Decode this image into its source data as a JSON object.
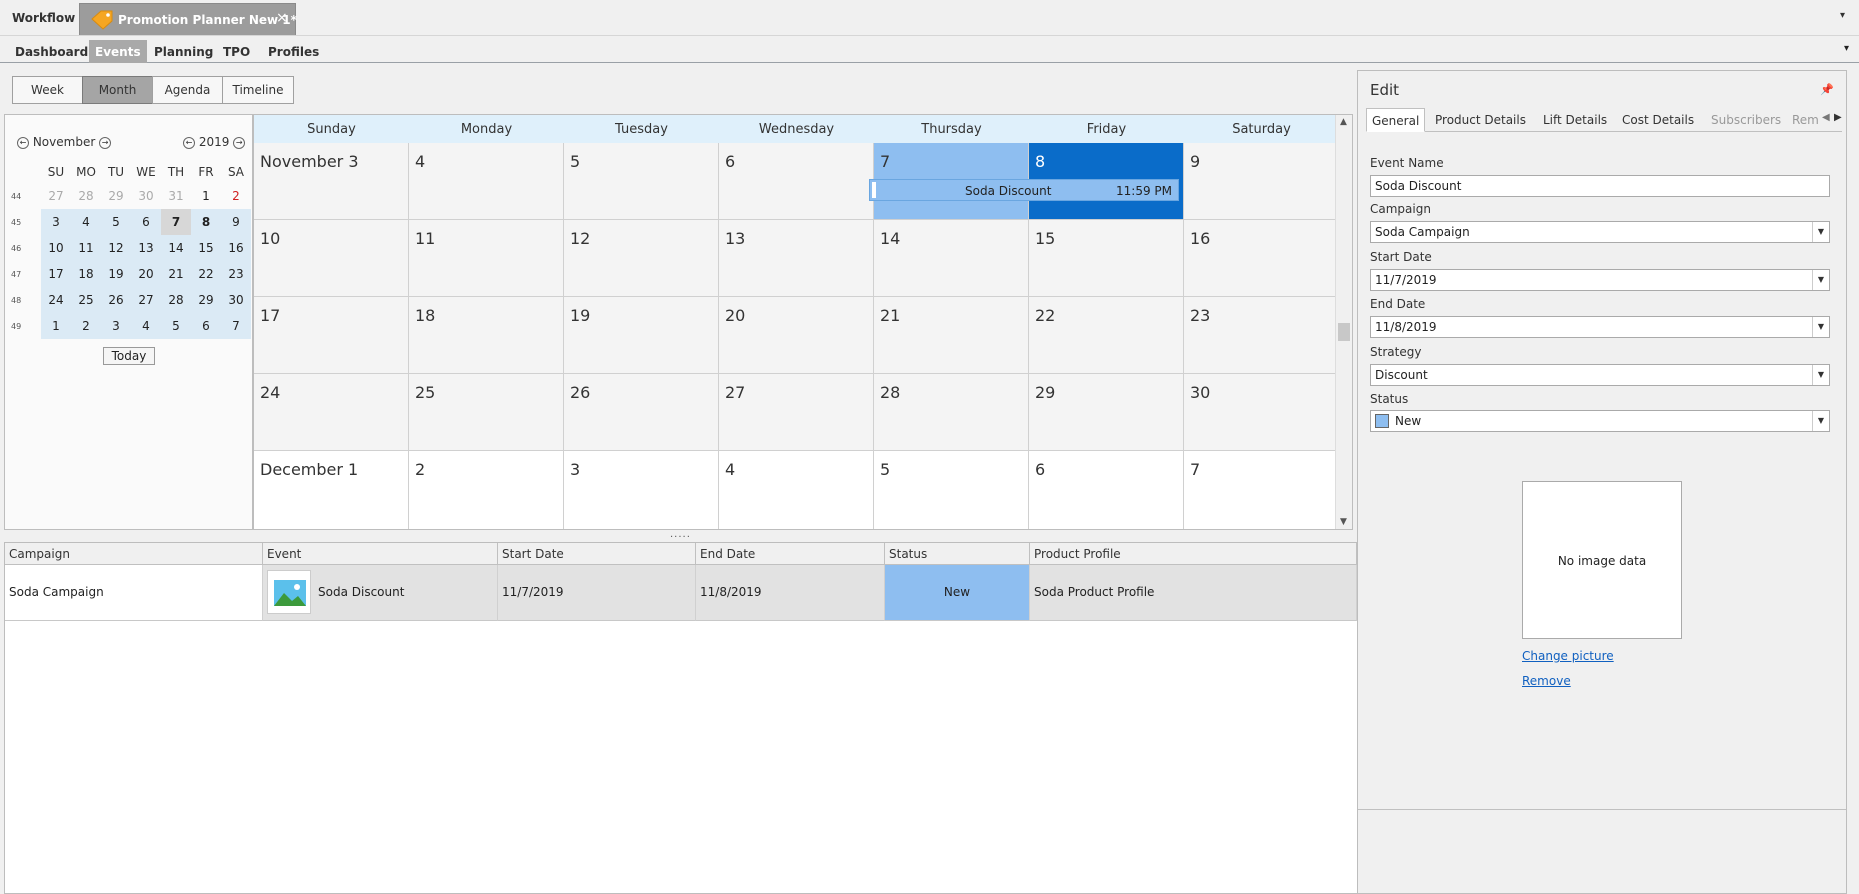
{
  "docbar": {
    "workflow": "Workflow",
    "doc_tab_title": "Promotion Planner New 1*",
    "close_glyph": "×",
    "menu_glyph": "▾"
  },
  "ribbon": {
    "tabs": [
      "Dashboard",
      "Events",
      "Planning",
      "TPO",
      "Profiles"
    ],
    "active": "Events"
  },
  "view_buttons": {
    "items": [
      "Week",
      "Month",
      "Agenda",
      "Timeline"
    ],
    "active": "Month"
  },
  "mini_calendar": {
    "month": "November",
    "year": "2019",
    "day_headers": [
      "SU",
      "MO",
      "TU",
      "WE",
      "TH",
      "FR",
      "SA"
    ],
    "week_numbers": [
      "44",
      "45",
      "46",
      "47",
      "48",
      "49"
    ],
    "weeks": [
      [
        "27",
        "28",
        "29",
        "30",
        "31",
        "1",
        "2"
      ],
      [
        "3",
        "4",
        "5",
        "6",
        "7",
        "8",
        "9"
      ],
      [
        "10",
        "11",
        "12",
        "13",
        "14",
        "15",
        "16"
      ],
      [
        "17",
        "18",
        "19",
        "20",
        "21",
        "22",
        "23"
      ],
      [
        "24",
        "25",
        "26",
        "27",
        "28",
        "29",
        "30"
      ],
      [
        "1",
        "2",
        "3",
        "4",
        "5",
        "6",
        "7"
      ]
    ],
    "today_label": "Today"
  },
  "month_view": {
    "day_names": [
      "Sunday",
      "Monday",
      "Tuesday",
      "Wednesday",
      "Thursday",
      "Friday",
      "Saturday"
    ],
    "weeks": [
      [
        "November 3",
        "4",
        "5",
        "6",
        "7",
        "8",
        "9"
      ],
      [
        "10",
        "11",
        "12",
        "13",
        "14",
        "15",
        "16"
      ],
      [
        "17",
        "18",
        "19",
        "20",
        "21",
        "22",
        "23"
      ],
      [
        "24",
        "25",
        "26",
        "27",
        "28",
        "29",
        "30"
      ],
      [
        "December 1",
        "2",
        "3",
        "4",
        "5",
        "6",
        "7"
      ]
    ],
    "appointment": {
      "name": "Soda Discount",
      "time": "11:59 PM"
    }
  },
  "splitter_glyph": ".....",
  "grid": {
    "columns": [
      "Campaign",
      "Event",
      "Start Date",
      "End Date",
      "Status",
      "Product Profile"
    ],
    "rows": [
      {
        "campaign": "Soda Campaign",
        "event": "Soda Discount",
        "start_date": "11/7/2019",
        "end_date": "11/8/2019",
        "status": "New",
        "product_profile": "Soda Product Profile"
      }
    ]
  },
  "edit_panel": {
    "title": "Edit",
    "pin_glyph": "📌",
    "tabs": [
      "General",
      "Product Details",
      "Lift Details",
      "Cost Details",
      "Subscribers",
      "Remi"
    ],
    "active_tab": "General",
    "fields": {
      "event_name_label": "Event Name",
      "event_name_value": "Soda Discount",
      "campaign_label": "Campaign",
      "campaign_value": "Soda Campaign",
      "start_date_label": "Start Date",
      "start_date_value": "11/7/2019",
      "end_date_label": "End Date",
      "end_date_value": "11/8/2019",
      "strategy_label": "Strategy",
      "strategy_value": "Discount",
      "status_label": "Status",
      "status_value": "New"
    },
    "picture_placeholder": "No image data",
    "change_picture": "Change picture",
    "remove": "Remove"
  },
  "colors": {
    "selection_light": "#8ebef0",
    "selection_dark": "#0a6cc9",
    "header_blue": "#dff0fb",
    "minical_highlight": "#dbeaf5"
  }
}
